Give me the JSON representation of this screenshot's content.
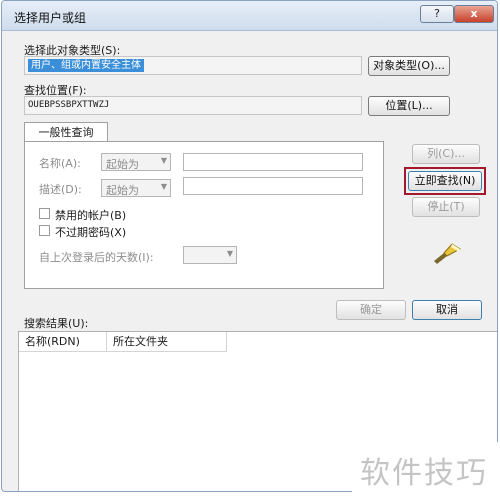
{
  "window": {
    "title": "选择用户或组",
    "help_label": "?",
    "close_label": "x"
  },
  "object_type": {
    "label": "选择此对象类型(S):",
    "value": "用户、组或内置安全主体",
    "button": "对象类型(O)..."
  },
  "location": {
    "label": "查找位置(F):",
    "value": "OUEBPSSBPXTTWZJ",
    "button": "位置(L)..."
  },
  "tab": {
    "label": "一般性查询"
  },
  "query": {
    "name_label": "名称(A):",
    "name_mode": "起始为",
    "desc_label": "描述(D):",
    "desc_mode": "起始为",
    "disabled_accounts_label": "禁用的帐户(B)",
    "non_expiring_pwd_label": "不过期密码(X)",
    "days_since_login_label": "自上次登录后的天数(I):",
    "dropdown_arrow": "▼"
  },
  "side_buttons": {
    "columns": "列(C)...",
    "find_now": "立即查找(N)",
    "stop": "停止(T)"
  },
  "footer": {
    "ok": "确定",
    "cancel": "取消",
    "results_label": "搜索结果(U):"
  },
  "results_table": {
    "columns": [
      "名称(RDN)",
      "所在文件夹"
    ]
  },
  "watermark": "软件技巧",
  "colors": {
    "selection": "#3a8fd8",
    "highlight_box": "#a3182c",
    "close_button": "#c7412b"
  }
}
